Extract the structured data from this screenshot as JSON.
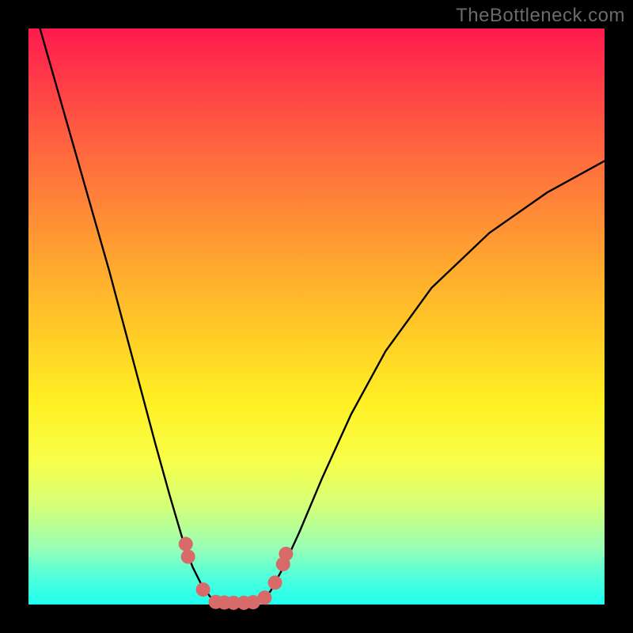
{
  "watermark": "TheBottleneck.com",
  "chart_data": {
    "type": "line",
    "title": "",
    "xlabel": "",
    "ylabel": "",
    "xlim": [
      0,
      100
    ],
    "ylim": [
      0,
      100
    ],
    "grid": false,
    "legend": false,
    "background": "red-yellow-green vertical gradient inside black frame",
    "series": [
      {
        "name": "left-branch",
        "x": [
          2,
          6,
          10,
          14,
          18,
          22,
          24.5,
          27,
          28.5,
          30,
          31.5,
          33
        ],
        "y": [
          100,
          86,
          72,
          58,
          43,
          28,
          19,
          10.5,
          6.5,
          3.5,
          1.4,
          0.3
        ]
      },
      {
        "name": "right-branch",
        "x": [
          40,
          42,
          44,
          47,
          51,
          56,
          62,
          70,
          80,
          90,
          100
        ],
        "y": [
          0.3,
          2.3,
          6.0,
          12.5,
          22.0,
          33.0,
          44.0,
          55.0,
          64.5,
          71.5,
          77.0
        ]
      }
    ],
    "groove_flat": {
      "x_start": 33,
      "x_end": 40,
      "y": 0.25
    },
    "markers": [
      {
        "x": 27.3,
        "y": 10.5
      },
      {
        "x": 27.7,
        "y": 8.3
      },
      {
        "x": 30.3,
        "y": 2.6
      },
      {
        "x": 32.5,
        "y": 0.45
      },
      {
        "x": 34.0,
        "y": 0.35
      },
      {
        "x": 35.6,
        "y": 0.3
      },
      {
        "x": 37.4,
        "y": 0.3
      },
      {
        "x": 39.0,
        "y": 0.4
      },
      {
        "x": 41.0,
        "y": 1.2
      },
      {
        "x": 42.8,
        "y": 3.8
      },
      {
        "x": 44.2,
        "y": 7.0
      },
      {
        "x": 44.7,
        "y": 8.8
      }
    ],
    "marker_color": "#d96a6a",
    "curve_color": "#000000"
  }
}
